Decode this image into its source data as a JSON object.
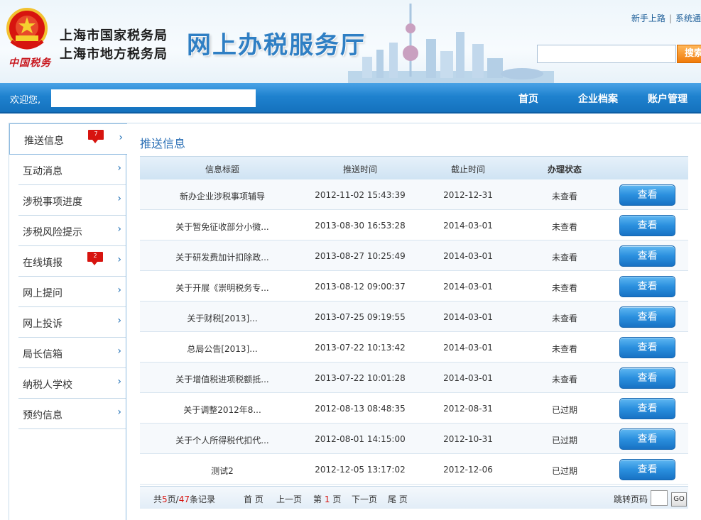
{
  "header": {
    "emblem_text": "中国税务",
    "bureau_line1": "上海市国家税务局",
    "bureau_line2": "上海市地方税务局",
    "hall_title": "网上办税服务厅",
    "links": [
      "新手上路",
      "系统通"
    ],
    "search_value": "",
    "search_button": "搜索"
  },
  "nav": {
    "welcome": "欢迎您,",
    "items": [
      "首页",
      "企业档案",
      "账户管理"
    ]
  },
  "sidebar": {
    "items": [
      {
        "label": "推送信息",
        "badge": "7"
      },
      {
        "label": "互动消息",
        "badge": ""
      },
      {
        "label": "涉税事项进度",
        "badge": ""
      },
      {
        "label": "涉税风险提示",
        "badge": ""
      },
      {
        "label": "在线填报",
        "badge": "2"
      },
      {
        "label": "网上提问",
        "badge": ""
      },
      {
        "label": "网上投诉",
        "badge": ""
      },
      {
        "label": "局长信箱",
        "badge": ""
      },
      {
        "label": "纳税人学校",
        "badge": ""
      },
      {
        "label": "预约信息",
        "badge": ""
      }
    ],
    "arrow": "›"
  },
  "main": {
    "title": "推送信息",
    "columns": [
      "信息标题",
      "推送时间",
      "截止时间",
      "办理状态"
    ],
    "view_label": "查看",
    "rows": [
      {
        "title": "新办企业涉税事项辅导",
        "push": "2012-11-02 15:43:39",
        "due": "2012-12-31",
        "status": "未查看"
      },
      {
        "title": "关于暂免征收部分小微...",
        "push": "2013-08-30 16:53:28",
        "due": "2014-03-01",
        "status": "未查看"
      },
      {
        "title": "关于研发费加计扣除政...",
        "push": "2013-08-27 10:25:49",
        "due": "2014-03-01",
        "status": "未查看"
      },
      {
        "title": "关于开展《崇明税务专...",
        "push": "2013-08-12 09:00:37",
        "due": "2014-03-01",
        "status": "未查看"
      },
      {
        "title": "关于财税[2013]...",
        "push": "2013-07-25 09:19:55",
        "due": "2014-03-01",
        "status": "未查看"
      },
      {
        "title": "总局公告[2013]...",
        "push": "2013-07-22 10:13:42",
        "due": "2014-03-01",
        "status": "未查看"
      },
      {
        "title": "关于增值税进项税额抵...",
        "push": "2013-07-22 10:01:28",
        "due": "2014-03-01",
        "status": "未查看"
      },
      {
        "title": "关于调整2012年8...",
        "push": "2012-08-13 08:48:35",
        "due": "2012-08-31",
        "status": "已过期"
      },
      {
        "title": "关于个人所得税代扣代...",
        "push": "2012-08-01 14:15:00",
        "due": "2012-10-31",
        "status": "已过期"
      },
      {
        "title": "测试2",
        "push": "2012-12-05 13:17:02",
        "due": "2012-12-06",
        "status": "已过期"
      }
    ]
  },
  "pager": {
    "prefix": "共",
    "pages": "5",
    "mid1": "页/",
    "records": "47",
    "suffix": "条记录",
    "first": "首 页",
    "prev": "上一页",
    "page_prefix": "第",
    "current": "1",
    "page_suffix": "页",
    "next": "下一页",
    "last": "尾 页",
    "goto_label": "跳转页码",
    "go": "GO"
  },
  "colors": {
    "accent": "#1f82cf",
    "badge": "#d7140f",
    "hall_title": "#2f7fc4"
  }
}
